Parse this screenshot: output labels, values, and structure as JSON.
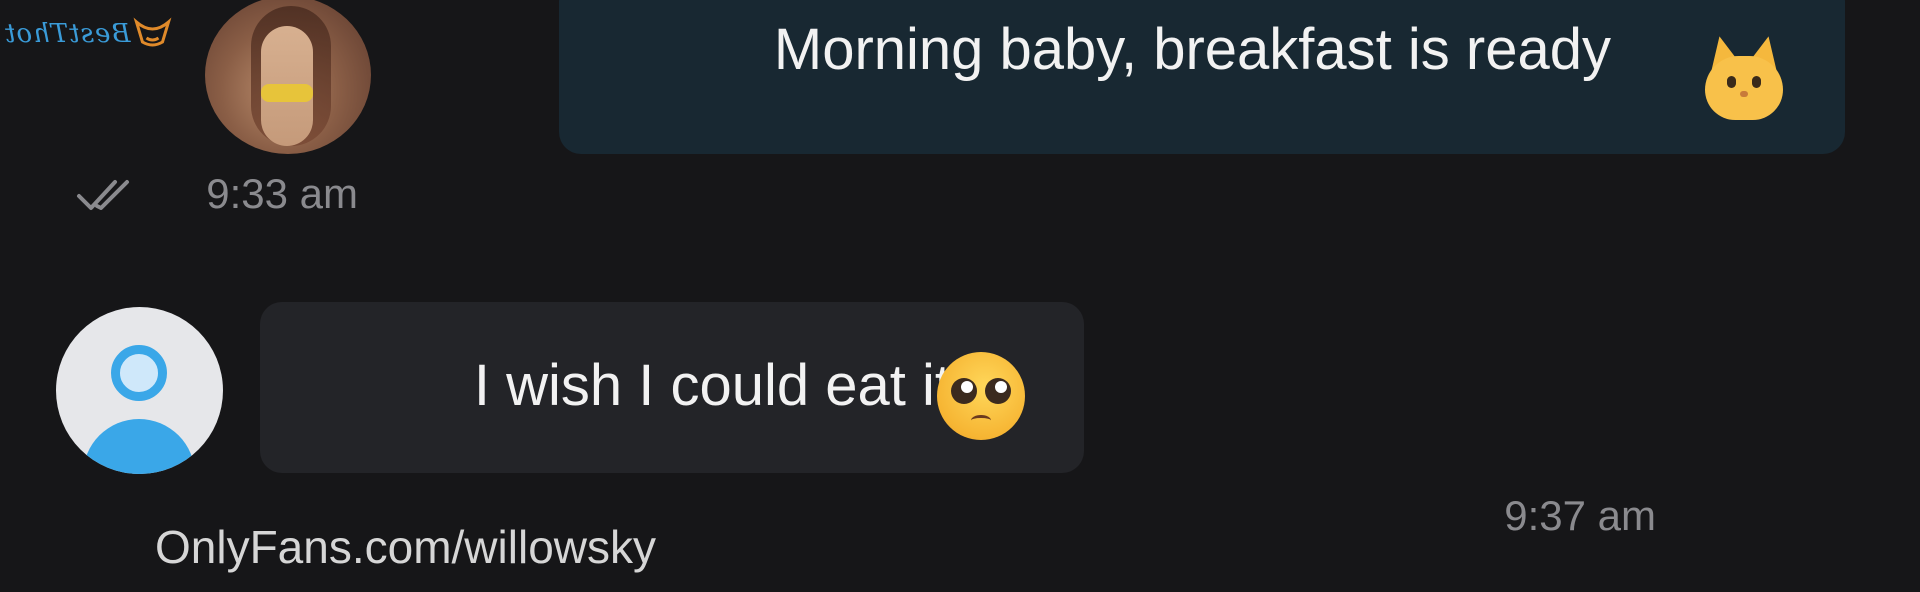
{
  "watermark": {
    "brand_text": "BestThot"
  },
  "messages": [
    {
      "sender": "other",
      "text": "Morning baby, breakfast is ready",
      "emoji_icon": "cat-face-emoji",
      "time": "9:33 am",
      "status_icon": "double-check-icon"
    },
    {
      "sender": "self",
      "text": "I wish I could eat it",
      "emoji_icon": "pleading-face-emoji",
      "time": "9:37 am"
    }
  ],
  "footer": {
    "watermark_text": "OnlyFans.com/willowsky"
  },
  "colors": {
    "background": "#161618",
    "bubble_incoming": "#182832",
    "bubble_outgoing": "#232428",
    "text": "#f2f2f2",
    "timestamp": "#8a8a8e",
    "accent": "#3aa7e8"
  }
}
